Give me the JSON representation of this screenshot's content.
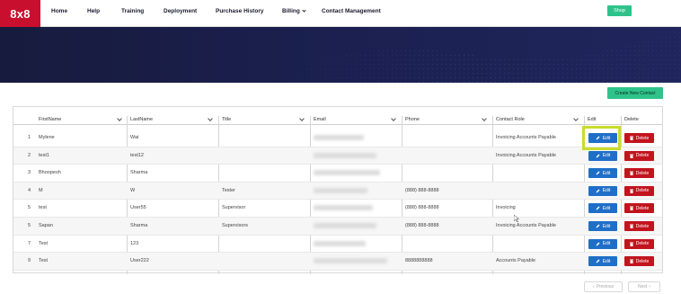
{
  "brand": {
    "logo_text": "8x8",
    "logo_color": "#c8102e"
  },
  "nav": {
    "items": [
      {
        "label": "Home"
      },
      {
        "label": "Help"
      },
      {
        "label": "Training"
      },
      {
        "label": "Deployment"
      },
      {
        "label": "Purchase History"
      },
      {
        "label": "Billing"
      },
      {
        "label": "Contact Management"
      }
    ],
    "shop_label": "Shop"
  },
  "actions": {
    "create_label": "Create New Contact"
  },
  "table": {
    "columns": [
      "FirstName",
      "LastName",
      "Title",
      "Email",
      "Phone",
      "Contact Role",
      "Edit",
      "Delete"
    ],
    "edit_label": "Edit",
    "delete_label": "Delete",
    "rows": [
      {
        "num": "1",
        "first": "Mylene",
        "last": "Wai",
        "title": "",
        "phone": "",
        "role": "Invoicing Accounts Payable"
      },
      {
        "num": "2",
        "first": "test1",
        "last": "test12",
        "title": "",
        "phone": "",
        "role": "Invoicing Accounts Payable"
      },
      {
        "num": "3",
        "first": "Bhoopesh",
        "last": "Sharma",
        "title": "",
        "phone": "",
        "role": ""
      },
      {
        "num": "4",
        "first": "M",
        "last": "W",
        "title": "Tester",
        "phone": "(888) 888-8888",
        "role": ""
      },
      {
        "num": "5",
        "first": "test",
        "last": "User55",
        "title": "Supervisor",
        "phone": "(888) 888-8888",
        "role": "Invoicing"
      },
      {
        "num": "5",
        "first": "Sapan",
        "last": "Sharma",
        "title": "Supervisors",
        "phone": "(888) 888-8888",
        "role": "Invoicing Accounts Payable"
      },
      {
        "num": "7",
        "first": "Test",
        "last": "123",
        "title": "",
        "phone": "",
        "role": ""
      },
      {
        "num": "9",
        "first": "Test",
        "last": "User222",
        "title": "",
        "phone": "8888888888",
        "role": "Accounts Payable"
      }
    ]
  },
  "pagination": {
    "previous_label": "Previous",
    "next_label": "Next"
  },
  "colors": {
    "accent_green": "#2ec38b",
    "edit_blue": "#1f6fc9",
    "delete_red": "#c3141e",
    "banner_navy": "#1b2050",
    "highlight": "#c9dc2c"
  }
}
